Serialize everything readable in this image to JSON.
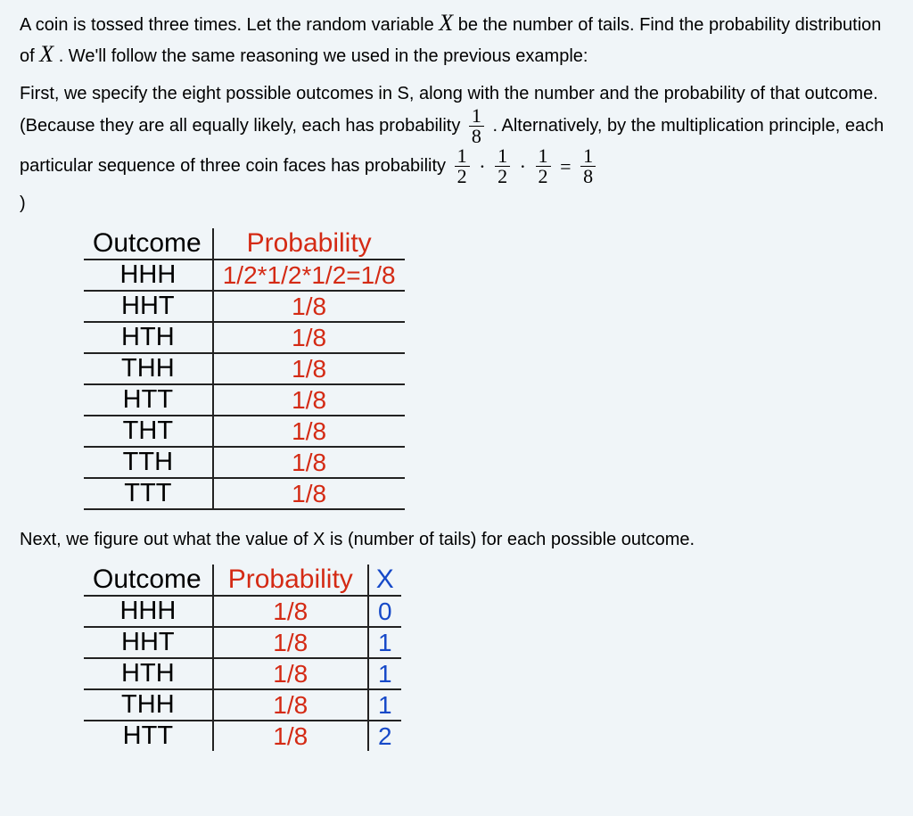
{
  "para1": {
    "a": "A coin is tossed three times. Let the random variable ",
    "b": "  be the number of tails. Find the probability distribution of ",
    "c": " . We'll follow the same reasoning we used in the previous example:"
  },
  "para2": {
    "a": "First, we specify the eight possible outcomes in S, along with the number and the probability of that outcome. (Because they are all equally likely, each has probability ",
    "b": " . Alternatively, by the multiplication principle, each particular sequence of three coin faces has probability "
  },
  "fr18": {
    "n": "1",
    "d": "8"
  },
  "fr12": {
    "n": "1",
    "d": "2"
  },
  "ops": {
    "dot": "·",
    "eq": "="
  },
  "paren": ")",
  "xvar": "X",
  "table1": {
    "headers": {
      "outcome": "Outcome",
      "prob": "Probability"
    },
    "rows": [
      {
        "outcome": "HHH",
        "prob": "1/2*1/2*1/2=1/8"
      },
      {
        "outcome": "HHT",
        "prob": "1/8"
      },
      {
        "outcome": "HTH",
        "prob": "1/8"
      },
      {
        "outcome": "THH",
        "prob": "1/8"
      },
      {
        "outcome": "HTT",
        "prob": "1/8"
      },
      {
        "outcome": "THT",
        "prob": "1/8"
      },
      {
        "outcome": "TTH",
        "prob": "1/8"
      },
      {
        "outcome": "TTT",
        "prob": "1/8"
      }
    ]
  },
  "para3": "Next, we figure out what the value of X is (number of tails) for each possible outcome.",
  "table2": {
    "headers": {
      "outcome": "Outcome",
      "prob": "Probability",
      "x": "X"
    },
    "rows": [
      {
        "outcome": "HHH",
        "prob": "1/8",
        "x": "0"
      },
      {
        "outcome": "HHT",
        "prob": "1/8",
        "x": "1"
      },
      {
        "outcome": "HTH",
        "prob": "1/8",
        "x": "1"
      },
      {
        "outcome": "THH",
        "prob": "1/8",
        "x": "1"
      },
      {
        "outcome": "HTT",
        "prob": "1/8",
        "x": "2"
      }
    ]
  }
}
